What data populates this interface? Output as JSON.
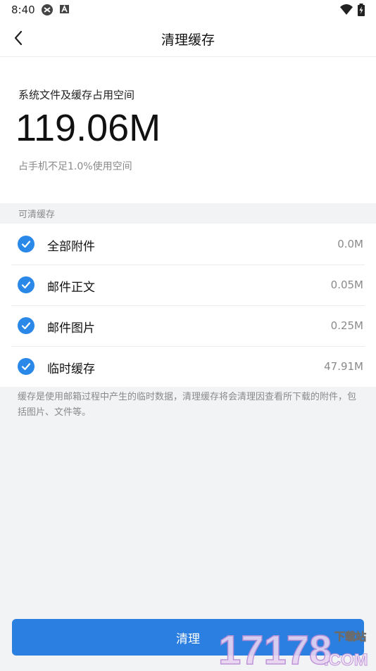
{
  "status": {
    "time": "8:40"
  },
  "header": {
    "title": "清理缓存"
  },
  "summary": {
    "label": "系统文件及缓存占用空间",
    "size": "119.06M",
    "sub": "占手机不足1.0%使用空间"
  },
  "section": {
    "title": "可清缓存"
  },
  "items": [
    {
      "label": "全部附件",
      "value": "0.0M",
      "checked": true
    },
    {
      "label": "邮件正文",
      "value": "0.05M",
      "checked": true
    },
    {
      "label": "邮件图片",
      "value": "0.25M",
      "checked": true
    },
    {
      "label": "临时缓存",
      "value": "47.91M",
      "checked": true
    }
  ],
  "note": "缓存是使用邮箱过程中产生的临时数据，清理缓存将会清理因查看所下载的附件，包括图片、文件等。",
  "button": {
    "label": "清理"
  },
  "watermark": {
    "text1": "17178",
    "text2": "下载站",
    "text3": ".COM"
  },
  "colors": {
    "accent": "#2a88e8",
    "button": "#2a7fe0"
  }
}
